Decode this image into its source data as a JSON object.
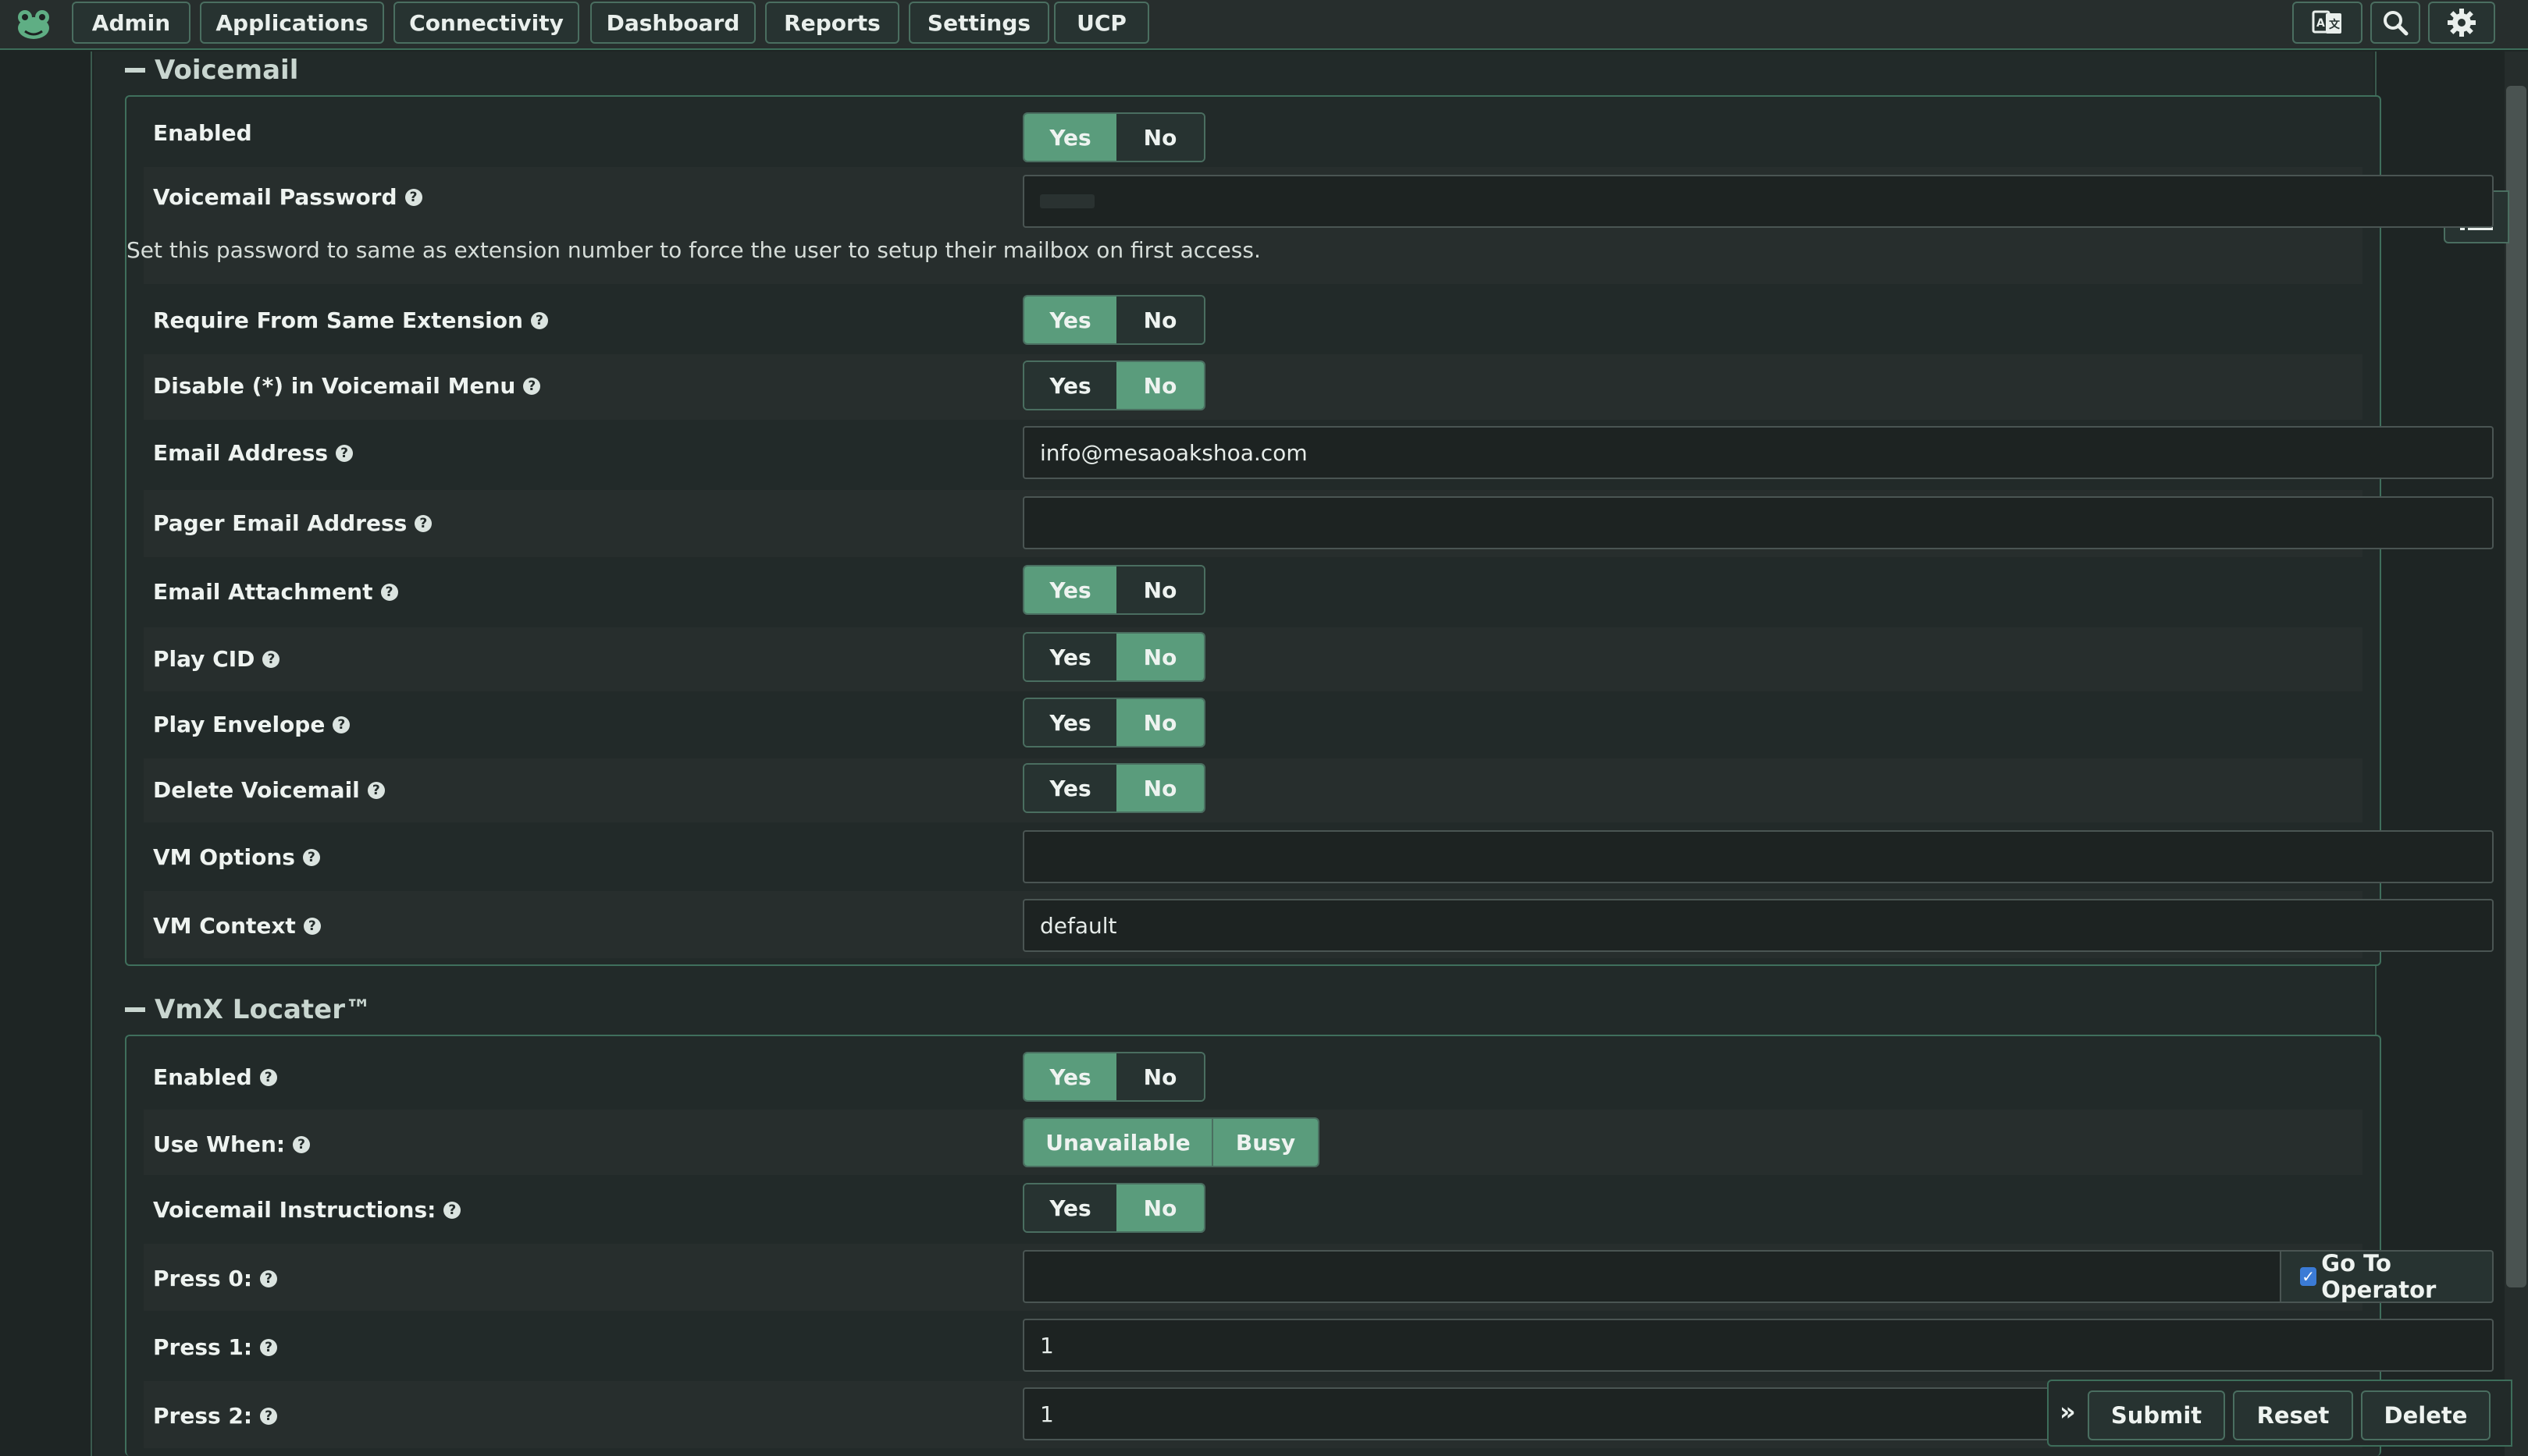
{
  "nav": {
    "items": [
      "Admin",
      "Applications",
      "Connectivity",
      "Dashboard",
      "Reports",
      "Settings",
      "UCP"
    ]
  },
  "voicemail": {
    "title": "Voicemail",
    "hint": "Set this password to same as extension number to force the user to setup their mailbox on first access.",
    "rows": {
      "enabled": "Enabled",
      "password": "Voicemail Password",
      "require_same_ext": "Require From Same Extension",
      "disable_star": "Disable (*) in Voicemail Menu",
      "email": "Email Address",
      "pager_email": "Pager Email Address",
      "email_attachment": "Email Attachment",
      "play_cid": "Play CID",
      "play_envelope": "Play Envelope",
      "delete_voicemail": "Delete Voicemail",
      "vm_options": "VM Options",
      "vm_context": "VM Context"
    },
    "values": {
      "email": "info@mesaoakshoa.com",
      "pager_email": "",
      "vm_options": "",
      "vm_context": "default"
    },
    "toggles": {
      "enabled": "Yes",
      "require_same_ext": "Yes",
      "disable_star": "No",
      "email_attachment": "Yes",
      "play_cid": "No",
      "play_envelope": "No",
      "delete_voicemail": "No"
    }
  },
  "vmx": {
    "title": "VmX Locater™",
    "rows": {
      "enabled": "Enabled",
      "use_when": "Use When:",
      "instructions": "Voicemail Instructions:",
      "press0": "Press 0:",
      "press1": "Press 1:",
      "press2": "Press 2:"
    },
    "values": {
      "press0": "",
      "press1": "1",
      "press2": "1"
    },
    "toggles": {
      "enabled": "Yes",
      "use_when": [
        "Unavailable",
        "Busy"
      ],
      "instructions": "No"
    },
    "go_to_operator": "Go To Operator",
    "go_to_operator_checked": true
  },
  "toggle_labels": {
    "yes": "Yes",
    "no": "No"
  },
  "actions": {
    "submit": "Submit",
    "reset": "Reset",
    "delete": "Delete"
  },
  "colors": {
    "accent": "#5a9c7c",
    "border": "#3f6f5c",
    "background": "#1e2524"
  }
}
